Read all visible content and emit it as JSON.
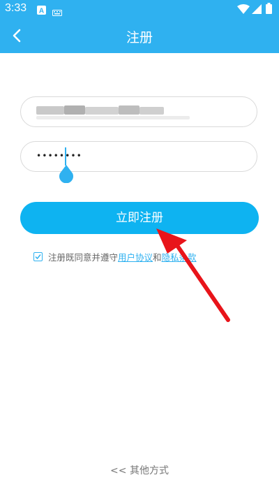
{
  "status_bar": {
    "time": "3:33",
    "icons": [
      "a-app-icon",
      "keyboard-icon",
      "wifi-icon",
      "signal-icon",
      "battery-icon"
    ]
  },
  "app_bar": {
    "title": "注册",
    "back_icon": "back-arrow-icon"
  },
  "form": {
    "phone_field": {
      "value": "",
      "blurred": true
    },
    "password_field": {
      "value": "••••••••"
    },
    "submit_label": "立即注册"
  },
  "agreement": {
    "checked": true,
    "text_prefix": "注册既同意并遵守",
    "user_agreement": "用户协议",
    "and": "和",
    "privacy_terms": "隐私条款"
  },
  "footer": {
    "other_methods": "<< 其他方式"
  },
  "colors": {
    "accent": "#2fb1f0",
    "button": "#0eb3f1",
    "annotation_arrow": "#e8141a"
  }
}
